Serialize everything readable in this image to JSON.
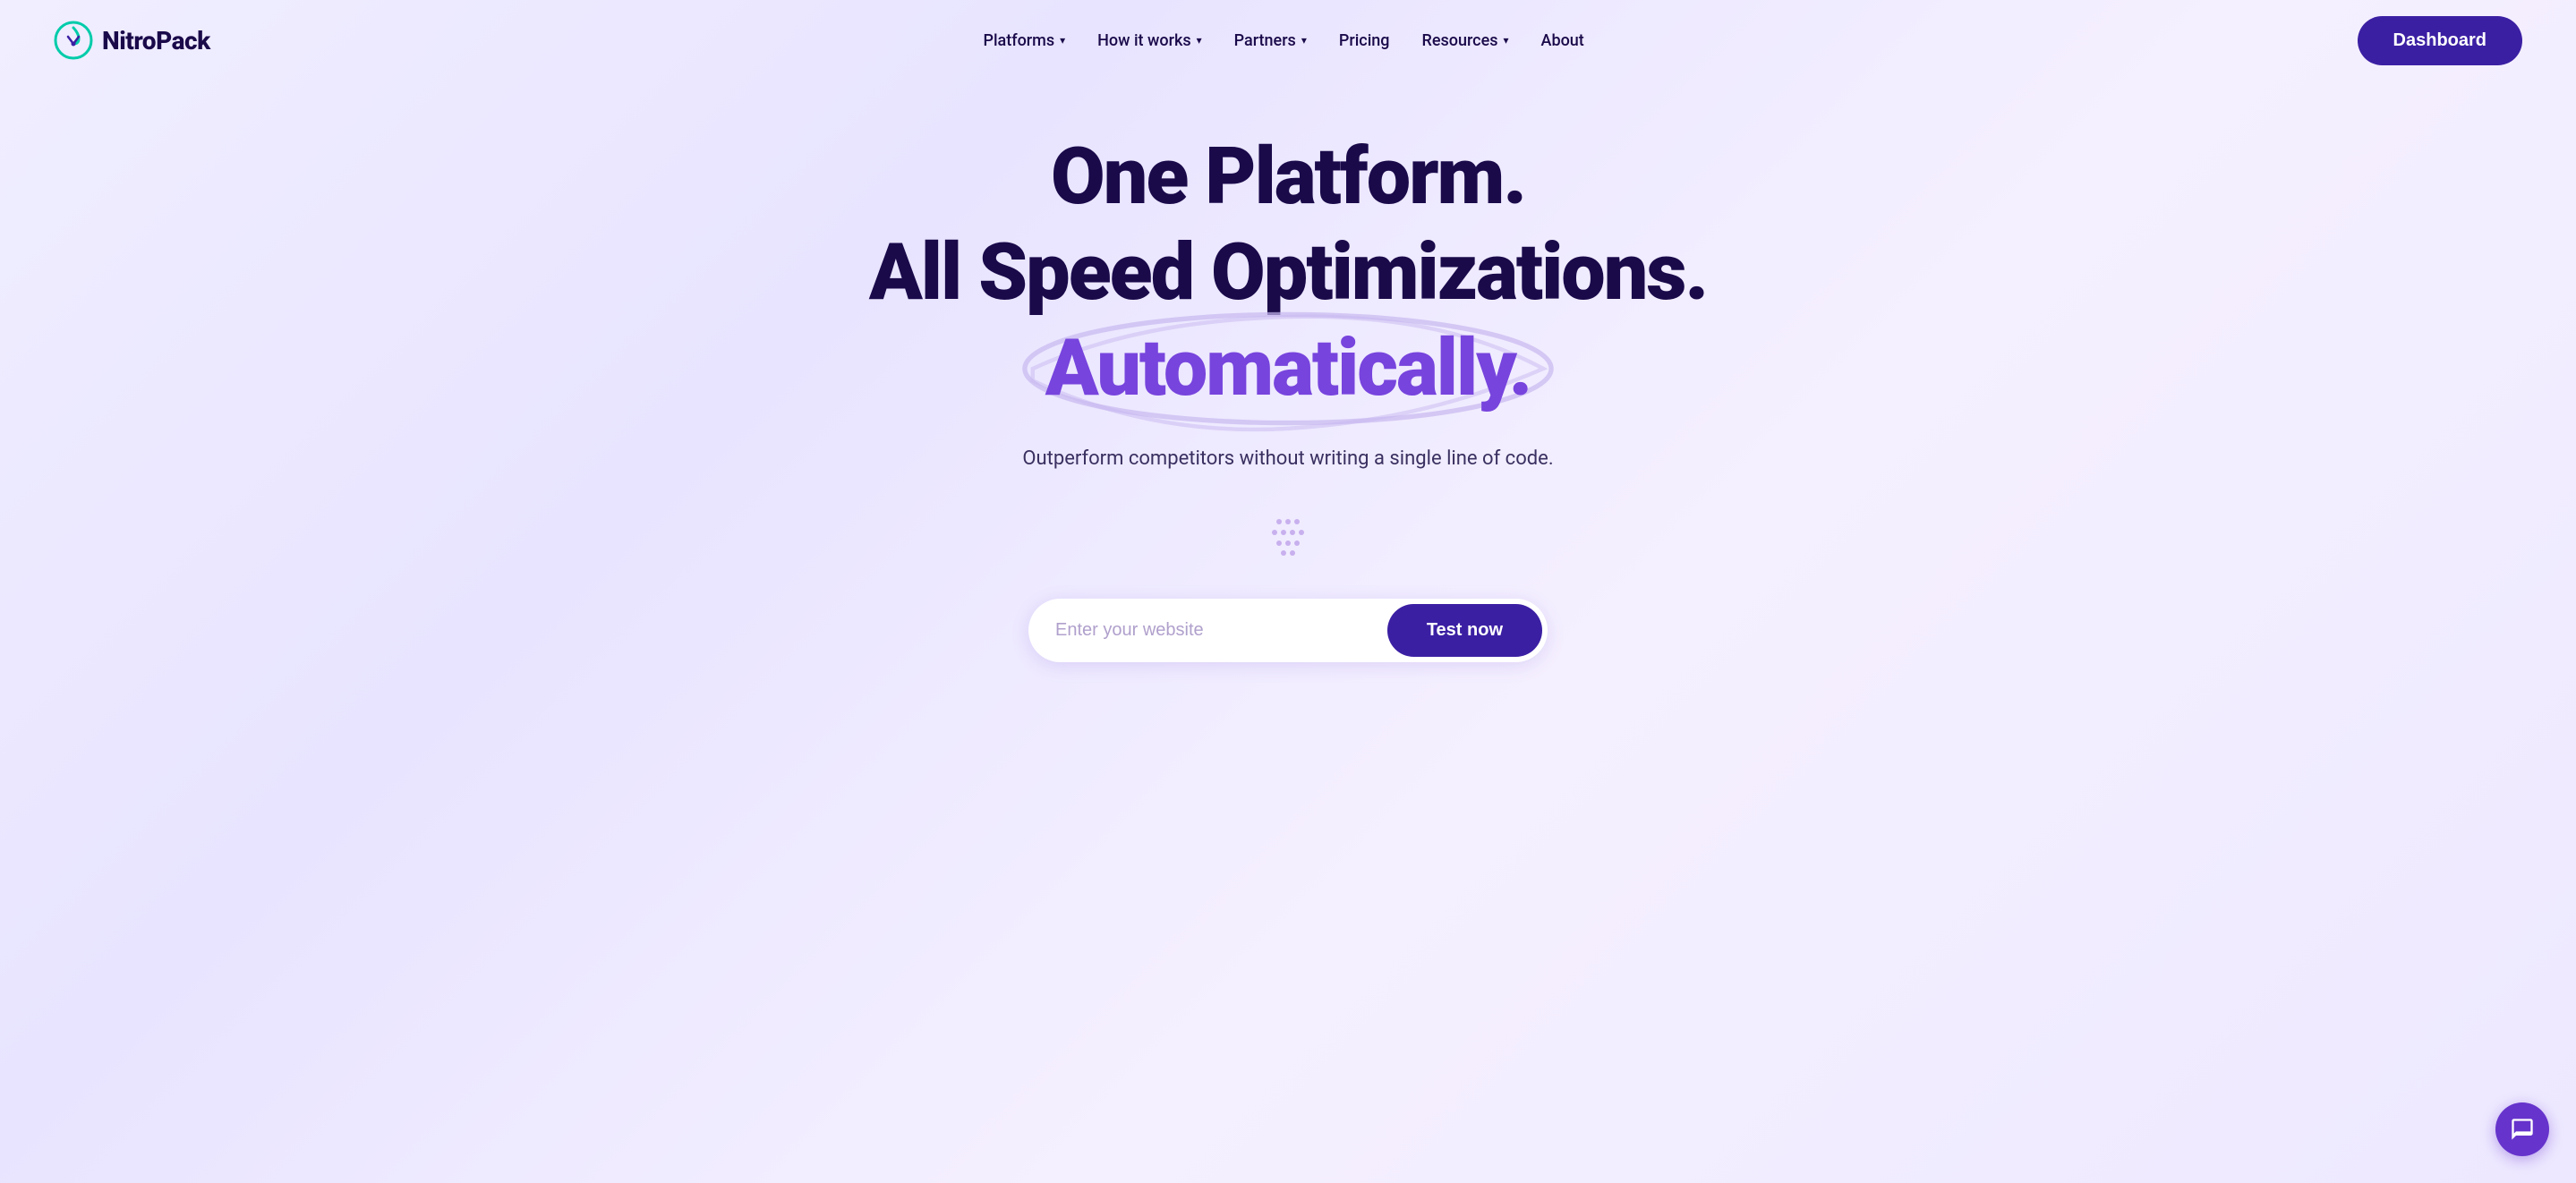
{
  "brand": {
    "name": "NitroPack",
    "logo_alt": "NitroPack logo"
  },
  "navbar": {
    "links": [
      {
        "label": "Platforms",
        "has_dropdown": true
      },
      {
        "label": "How it works",
        "has_dropdown": true
      },
      {
        "label": "Partners",
        "has_dropdown": true
      },
      {
        "label": "Pricing",
        "has_dropdown": false
      },
      {
        "label": "Resources",
        "has_dropdown": true
      },
      {
        "label": "About",
        "has_dropdown": false
      }
    ],
    "cta_label": "Dashboard"
  },
  "hero": {
    "line1": "One Platform.",
    "line2": "All Speed Optimizations.",
    "line3": "Automatically.",
    "subtitle": "Outperform competitors without writing a single line of code.",
    "input_placeholder": "Enter your website",
    "cta_label": "Test now"
  },
  "colors": {
    "brand_dark": "#1a0a4a",
    "brand_purple": "#7744dd",
    "brand_button": "#3b1fa3",
    "oval_stroke": "#c8b8ee"
  }
}
